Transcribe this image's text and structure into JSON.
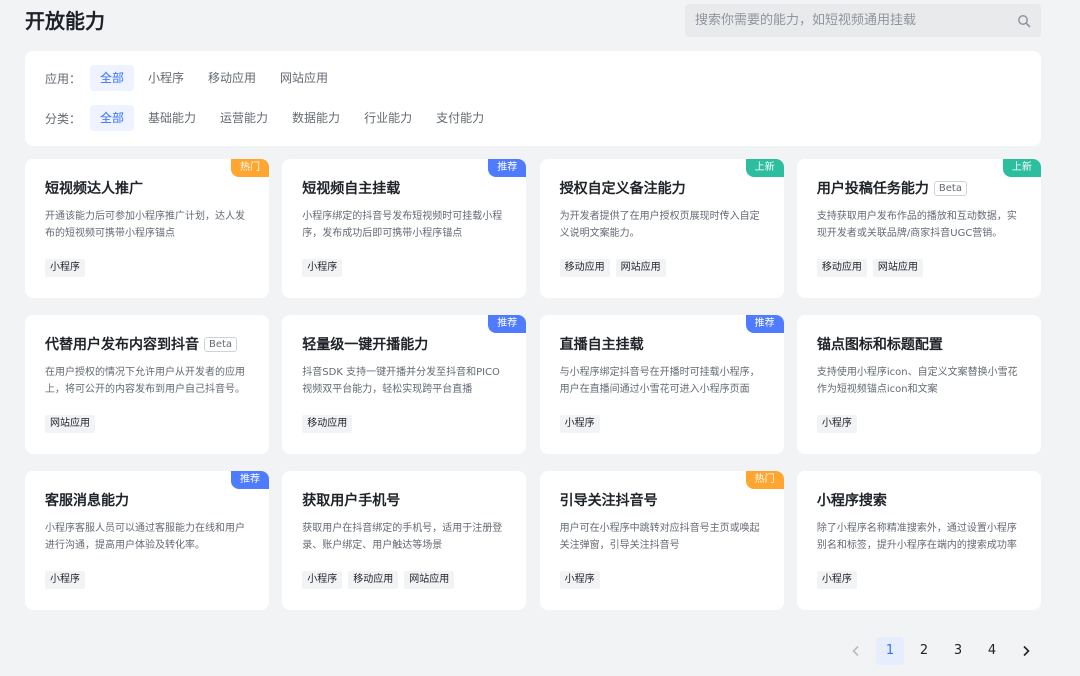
{
  "header": {
    "title": "开放能力",
    "search_placeholder": "搜索你需要的能力，如短视频通用挂载"
  },
  "filters": {
    "app": {
      "label": "应用：",
      "options": [
        "全部",
        "小程序",
        "移动应用",
        "网站应用"
      ],
      "selected": "全部"
    },
    "category": {
      "label": "分类：",
      "options": [
        "全部",
        "基础能力",
        "运营能力",
        "数据能力",
        "行业能力",
        "支付能力"
      ],
      "selected": "全部"
    }
  },
  "cards": [
    {
      "title": "短视频达人推广",
      "badge": "热门",
      "badge_type": "hot",
      "desc": "开通该能力后可参加小程序推广计划，达人发布的短视频可携带小程序锚点",
      "tags": [
        "小程序"
      ]
    },
    {
      "title": "短视频自主挂载",
      "badge": "推荐",
      "badge_type": "rec",
      "desc": "小程序绑定的抖音号发布短视频时可挂载小程序，发布成功后即可携带小程序锚点",
      "tags": [
        "小程序"
      ]
    },
    {
      "title": "授权自定义备注能力",
      "badge": "上新",
      "badge_type": "new",
      "desc": "为开发者提供了在用户授权页展现时传入自定义说明文案能力。",
      "tags": [
        "移动应用",
        "网站应用"
      ]
    },
    {
      "title": "用户投稿任务能力",
      "beta": "Beta",
      "badge": "上新",
      "badge_type": "new",
      "desc": "支持获取用户发布作品的播放和互动数据，实现开发者或关联品牌/商家抖音UGC营销。",
      "tags": [
        "移动应用",
        "网站应用"
      ]
    },
    {
      "title": "代替用户发布内容到抖音",
      "beta": "Beta",
      "desc": "在用户授权的情况下允许用户从开发者的应用上，将可公开的内容发布到用户自己抖音号。",
      "tags": [
        "网站应用"
      ]
    },
    {
      "title": "轻量级一键开播能力",
      "badge": "推荐",
      "badge_type": "rec",
      "desc": "抖音SDK 支持一键开播并分发至抖音和PICO视频双平台能力，轻松实现跨平台直播",
      "tags": [
        "移动应用"
      ]
    },
    {
      "title": "直播自主挂载",
      "badge": "推荐",
      "badge_type": "rec",
      "desc": "与小程序绑定抖音号在开播时可挂载小程序，用户在直播间通过小雪花可进入小程序页面",
      "tags": [
        "小程序"
      ]
    },
    {
      "title": "锚点图标和标题配置",
      "desc": "支持使用小程序icon、自定义文案替换小雪花作为短视频锚点icon和文案",
      "tags": [
        "小程序"
      ]
    },
    {
      "title": "客服消息能力",
      "badge": "推荐",
      "badge_type": "rec",
      "desc": "小程序客服人员可以通过客服能力在线和用户进行沟通，提高用户体验及转化率。",
      "tags": [
        "小程序"
      ]
    },
    {
      "title": "获取用户手机号",
      "desc": "获取用户在抖音绑定的手机号，适用于注册登录、账户绑定、用户触达等场景",
      "tags": [
        "小程序",
        "移动应用",
        "网站应用"
      ]
    },
    {
      "title": "引导关注抖音号",
      "badge": "热门",
      "badge_type": "hot",
      "desc": "用户可在小程序中跳转对应抖音号主页或唤起关注弹窗，引导关注抖音号",
      "tags": [
        "小程序"
      ]
    },
    {
      "title": "小程序搜索",
      "desc": "除了小程序名称精准搜索外，通过设置小程序别名和标签，提升小程序在端内的搜索成功率",
      "tags": [
        "小程序"
      ]
    }
  ],
  "pagination": {
    "pages": [
      "1",
      "2",
      "3",
      "4"
    ],
    "current": "1"
  }
}
